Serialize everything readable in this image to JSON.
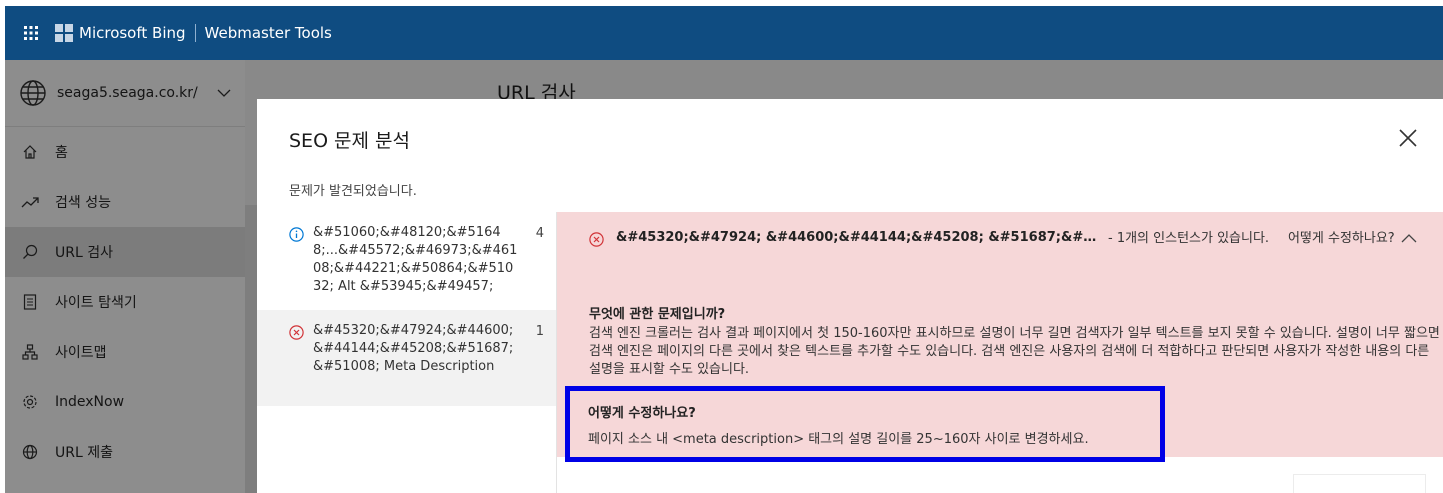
{
  "header": {
    "brand": "Microsoft Bing",
    "product": "Webmaster Tools",
    "waffle_icon": "app-launcher-icon",
    "background": "#0f4c81"
  },
  "sidebar": {
    "site": "seaga5.seaga.co.kr/",
    "items": [
      {
        "label": "홈",
        "icon": "home-icon",
        "active": false
      },
      {
        "label": "검색 성능",
        "icon": "trend-icon",
        "active": false
      },
      {
        "label": "URL 검사",
        "icon": "search-icon",
        "active": true
      },
      {
        "label": "사이트 탐색기",
        "icon": "document-icon",
        "active": false
      },
      {
        "label": "사이트맵",
        "icon": "sitemap-icon",
        "active": false
      },
      {
        "label": "IndexNow",
        "icon": "gear-icon",
        "active": false
      },
      {
        "label": "URL 제출",
        "icon": "globe-icon",
        "active": false
      }
    ]
  },
  "page": {
    "title": "URL 검사"
  },
  "modal": {
    "title": "SEO 문제 분석",
    "subtitle": "문제가 발견되었습니다.",
    "issues": [
      {
        "type": "info",
        "text": "&#51060;&#48120;&#51648;...&#45572;&#46973;&#46108;&#44221;&#50864;&#51032; Alt &#53945;&#49457;",
        "count": "4"
      },
      {
        "type": "error",
        "text": "&#45320;&#47924;&#44600;&#44144;&#45208;&#51687;&#51008; Meta Description",
        "count": "1"
      }
    ],
    "detail": {
      "issue_name": "&#45320;&#47924; &#44600;&#44144;&#45208; &#51687;&#51008; Meta ...",
      "instances": "- 1개의 인스턴스가 있습니다.",
      "howto_link": "어떻게 수정하나요?",
      "what_title": "무엇에 관한 문제입니까?",
      "what_body": "검색 엔진 크롤러는 검사 결과 페이지에서 첫 150-160자만 표시하므로 설명이 너무 길면 검색자가 일부 텍스트를 보지 못할 수 있습니다. 설명이 너무 짧으면 검색 엔진은 페이지의 다른 곳에서 찾은 텍스트를 추가할 수도 있습니다. 검색 엔진은 사용자의 검색에 더 적합하다고 판단되면 사용자가 작성한 내용의 다른 설명을 표시할 수도 있습니다.",
      "fix_title": "어떻게 수정하나요?",
      "fix_body": "페이지 소스 내 <meta description> 태그의 설명 길이를 25~160자 사이로 변경하세요."
    },
    "colors": {
      "error_bg": "#f6d7d8",
      "highlight_border": "#0000e6",
      "error_icon": "#d13438",
      "info_icon": "#0078d4"
    }
  }
}
